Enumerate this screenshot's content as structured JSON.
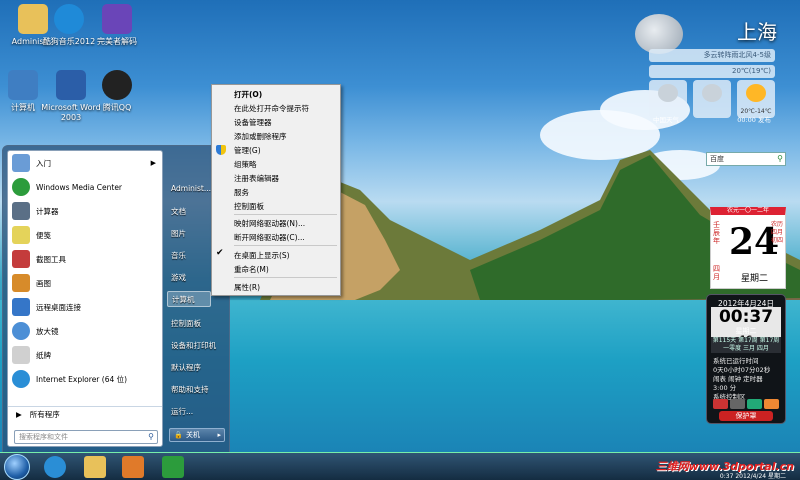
{
  "desktop_icons": [
    {
      "label": "Administ...",
      "color": "#e8c15a"
    },
    {
      "label": "酷狗音乐2012",
      "color": "#1f8ad8"
    },
    {
      "label": "完美者解码",
      "color": "#6a45b8"
    },
    {
      "label": "计算机",
      "color": "#3f7ec2"
    },
    {
      "label": "Microsoft Word 2003",
      "color": "#2b5ea8"
    },
    {
      "label": "腾讯QQ",
      "color": "#222222"
    }
  ],
  "start_menu": {
    "programs": [
      {
        "label": "入门",
        "has_arrow": true,
        "color": "#6a9cd6"
      },
      {
        "label": "Windows Media Center",
        "has_arrow": false,
        "color": "#2c9c3c"
      },
      {
        "label": "计算器",
        "has_arrow": false,
        "color": "#5a6f86"
      },
      {
        "label": "便笺",
        "has_arrow": false,
        "color": "#e4d35a"
      },
      {
        "label": "截图工具",
        "has_arrow": false,
        "color": "#c43c3c"
      },
      {
        "label": "画图",
        "has_arrow": false,
        "color": "#d78b2a"
      },
      {
        "label": "远程桌面连接",
        "has_arrow": false,
        "color": "#3576c8"
      },
      {
        "label": "放大镜",
        "has_arrow": false,
        "color": "#4c8fd6"
      },
      {
        "label": "纸牌",
        "has_arrow": false,
        "color": "#d0d0d0"
      },
      {
        "label": "Internet Explorer (64 位)",
        "has_arrow": false,
        "color": "#2a8ed6"
      }
    ],
    "all_programs": "所有程序",
    "search_placeholder": "搜索程序和文件",
    "right_items": [
      "Administ...",
      "文档",
      "图片",
      "音乐",
      "游戏",
      "计算机",
      "控制面板",
      "设备和打印机",
      "默认程序",
      "帮助和支持",
      "运行..."
    ],
    "shutdown_label": "关机"
  },
  "context_menu": {
    "items": [
      "打开(O)",
      "在此处打开命令提示符",
      "设备管理器",
      "添加或删除程序",
      "管理(G)",
      "组策略",
      "注册表编辑器",
      "服务",
      "控制面板",
      "映射网络驱动器(N)...",
      "断开网络驱动器(C)...",
      "在桌面上显示(S)",
      "重命名(M)",
      "属性(R)"
    ],
    "checked_item": "在桌面上显示(S)"
  },
  "weather": {
    "city": "上海",
    "condition": "多云转阵雨北风4-5级",
    "temp": "20℃(19℃)",
    "forecast": [
      "",
      "",
      "20℃-14℃"
    ],
    "source": "中国天气",
    "time": "00:00 发布"
  },
  "search_gadget": {
    "value": "百度"
  },
  "calendar": {
    "top": "农元一〇一二年",
    "day": "24",
    "left_lunar": "壬辰年",
    "right_lunar": "农历四月初四",
    "month": "四月",
    "weekday": "星期二"
  },
  "clock": {
    "date": "2012年4月24日",
    "time": "00:37",
    "seconds": "16",
    "weekday": "星期二",
    "grid_line1": "第115天 第17周 第17周",
    "grid_line2": "一零度 三月 四月",
    "line1": "系统已运行时间",
    "line2": "0天0小时07分02秒",
    "line3": "闹表 闹钟 定时器",
    "line4": "3:00 分",
    "line5": "系统控制区",
    "guard": "保护罩"
  },
  "taskbar": {
    "watermark": "三维网www.3dportal.cn",
    "tray_time": "0:37",
    "tray_date": "2012/4/24 星期二"
  }
}
